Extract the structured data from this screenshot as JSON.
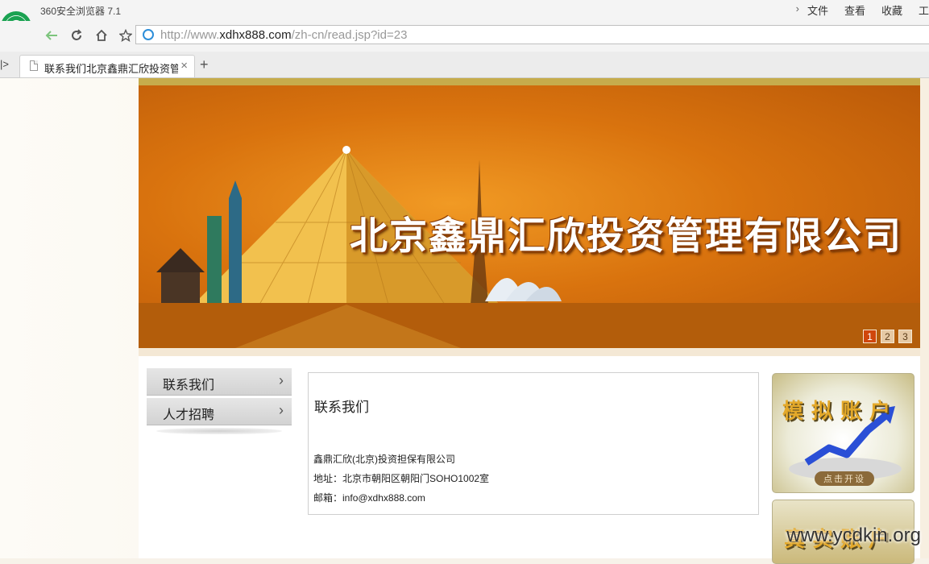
{
  "browser": {
    "app_title": "360安全浏览器  7.1",
    "menu": [
      "文件",
      "查看",
      "收藏",
      "工"
    ],
    "address_url_prefix": "http://www.",
    "address_url_domain": "xdhx888.com",
    "address_url_path": "/zh-cn/read.jsp?id=23",
    "tab_title": "联系我们北京鑫鼎汇欣投资管理",
    "new_tab_label": "+",
    "close_label": "×",
    "collapse_label": "|>",
    "accent_color": "#1aa251"
  },
  "banner": {
    "title": "北京鑫鼎汇欣投资管理有限公司",
    "slides": [
      "1",
      "2",
      "3"
    ],
    "active_slide": "1"
  },
  "left_nav": {
    "items": [
      {
        "label": "联系我们"
      },
      {
        "label": "人才招聘"
      }
    ]
  },
  "content": {
    "heading": "联系我们",
    "company": "鑫鼎汇欣(北京)投资担保有限公司",
    "address_label": "地址：",
    "address": "北京市朝阳区朝阳门SOHO1002室",
    "email_label": "邮箱：",
    "email": "info@xdhx888.com"
  },
  "promos": [
    {
      "title": "模拟账户",
      "button": "点击开设"
    },
    {
      "title": "真实账户"
    }
  ],
  "watermark": "www.ycdkin.org"
}
